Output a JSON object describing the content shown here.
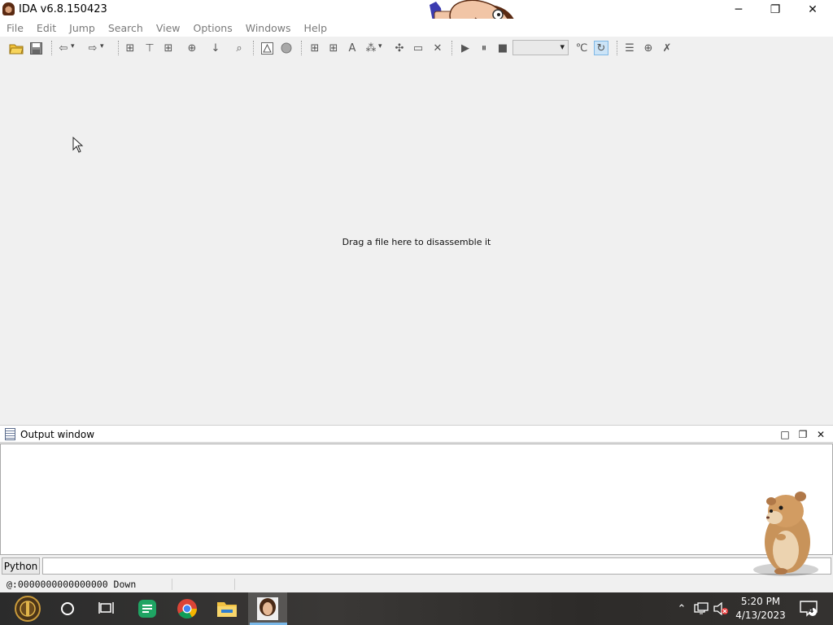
{
  "window": {
    "title": "IDA v6.8.150423"
  },
  "window_buttons": {
    "minimize": "─",
    "maximize": "❐",
    "close": "✕"
  },
  "menu": [
    "File",
    "Edit",
    "Jump",
    "Search",
    "View",
    "Options",
    "Windows",
    "Help"
  ],
  "toolbar": {
    "icons": [
      "open-file-icon",
      "save-icon",
      "back-icon",
      "forward-icon",
      "code-icon",
      "data-icon",
      "unexplored-icon",
      "text-search-icon",
      "next-code-icon",
      "immediate-search-icon",
      "graph-icon",
      "circle-icon",
      "make-code-icon",
      "make-data-icon",
      "make-string-icon",
      "make-array-icon",
      "make-struct-icon",
      "rename-icon",
      "undefine-icon",
      "run-icon",
      "pause-icon",
      "stop-icon",
      "decompile-icon",
      "refresh-icon",
      "segments-icon",
      "add-breakpoint-icon",
      "delete-breakpoint-icon"
    ]
  },
  "main": {
    "hint": "Drag a file here to disassemble it"
  },
  "output": {
    "title": "Output window",
    "buttons": {
      "maximize": "□",
      "restore": "❐",
      "close": "✕"
    }
  },
  "cmdline": {
    "lang_button": "Python",
    "value": ""
  },
  "status": {
    "address": "@:0000000000000000 Down"
  },
  "taskbar": {
    "apps": [
      "start-button-icon",
      "cortana-icon",
      "task-view-icon",
      "messages-app-icon",
      "chrome-icon",
      "file-explorer-icon",
      "ida-app-icon"
    ],
    "tray": [
      "chevron-up-icon",
      "network-icon",
      "volume-muted-icon"
    ],
    "time": "5:20 PM",
    "date": "4/13/2023",
    "notification_count": "4"
  }
}
